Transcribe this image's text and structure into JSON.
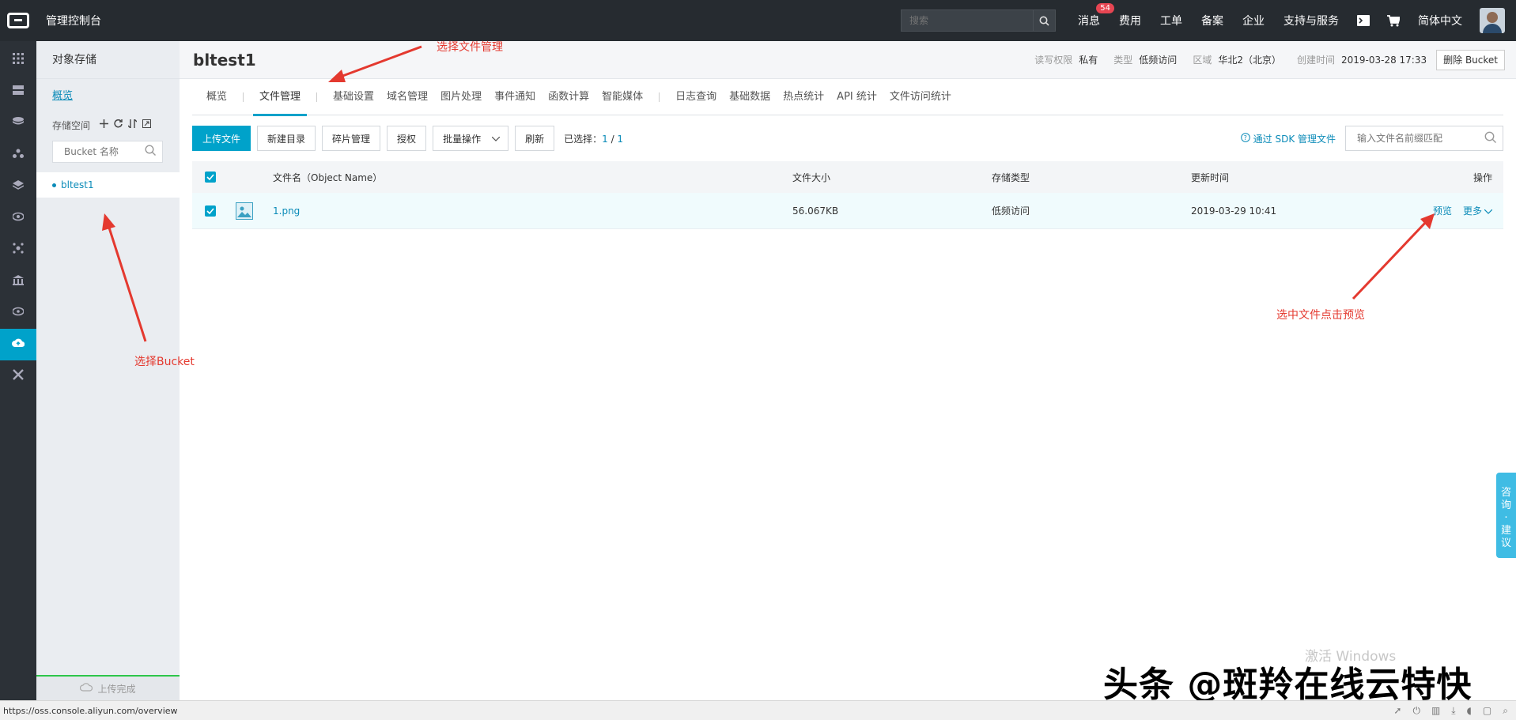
{
  "topbar": {
    "console_title": "管理控制台",
    "search_placeholder": "搜索",
    "nav": [
      "消息",
      "费用",
      "工单",
      "备案",
      "企业",
      "支持与服务"
    ],
    "message_badge": "54",
    "language": "简体中文"
  },
  "sidebar": {
    "title": "对象存储",
    "overview": "概览",
    "storage_label": "存储空间",
    "bucket_search_placeholder": "Bucket 名称",
    "buckets": [
      "bltest1"
    ],
    "upload_done": "上传完成"
  },
  "header": {
    "bucket_name": "bltest1",
    "acl_label": "读写权限",
    "acl_value": "私有",
    "type_label": "类型",
    "type_value": "低频访问",
    "region_label": "区域",
    "region_value": "华北2（北京）",
    "created_label": "创建时间",
    "created_value": "2019-03-28 17:33",
    "delete_button": "删除 Bucket"
  },
  "tabs": {
    "group1": [
      "概览",
      "文件管理"
    ],
    "group2": [
      "基础设置",
      "域名管理",
      "图片处理",
      "事件通知",
      "函数计算",
      "智能媒体"
    ],
    "group3": [
      "日志查询",
      "基础数据",
      "热点统计",
      "API 统计",
      "文件访问统计"
    ],
    "active": "文件管理"
  },
  "toolbar": {
    "upload": "上传文件",
    "new_dir": "新建目录",
    "fragments": "碎片管理",
    "authorize": "授权",
    "batch": "批量操作",
    "refresh": "刷新",
    "selected_label": "已选择：",
    "selected_count": "1",
    "selected_sep": " / ",
    "selected_total": "1",
    "sdk_link": "通过 SDK 管理文件",
    "file_search_placeholder": "输入文件名前缀匹配"
  },
  "table": {
    "headers": {
      "name": "文件名（Object Name）",
      "size": "文件大小",
      "storage": "存储类型",
      "updated": "更新时间",
      "ops": "操作"
    },
    "rows": [
      {
        "name": "1.png",
        "size": "56.067KB",
        "storage": "低频访问",
        "updated": "2019-03-29 10:41",
        "preview": "预览",
        "more": "更多"
      }
    ]
  },
  "annotations": {
    "select_file_mgmt": "选择文件管理",
    "select_bucket": "选择Bucket",
    "select_preview": "选中文件点击预览"
  },
  "consult": [
    "咨",
    "询",
    "·",
    "建",
    "议"
  ],
  "statusbar": {
    "url": "https://oss.console.aliyun.com/overview"
  },
  "watermark": {
    "text": "头条 @斑羚在线云特快",
    "windows": "激活 Windows"
  },
  "colors": {
    "accent": "#00a2ca",
    "link": "#0b8bb8",
    "topbar": "#262b30",
    "annotation": "#e4392f"
  }
}
